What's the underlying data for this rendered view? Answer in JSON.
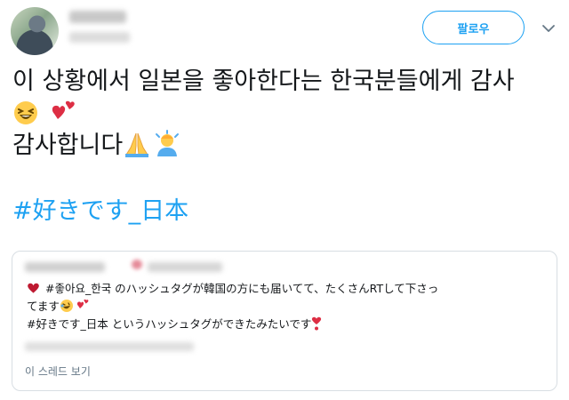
{
  "header": {
    "follow_label": "팔로우"
  },
  "tweet": {
    "line1": "이 상황에서 일본을 좋아한다는 한국분들에게 감사",
    "line3": "감사합니다",
    "hashtag": "#好きです_日本"
  },
  "quoted_tweet": {
    "line1": " #좋아요_한국 のハッシュタグが韓国の方にも届いてて、たくさんRTして下さっ",
    "line2": "てます",
    "line3": "#好きです_日本 というハッシュタグができたみたいです",
    "thread_link": "이 스레드 보기"
  },
  "colors": {
    "accent": "#1da1f2",
    "text": "#14171a",
    "muted": "#657786",
    "border": "#d8dee3"
  },
  "icons": [
    "chevron-down-icon",
    "laughing-emoji",
    "two-hearts-emoji",
    "folded-hands-emoji",
    "person-bowing-emoji",
    "red-heart-emoji",
    "rofl-emoji",
    "heavy-heart-exclamation-emoji"
  ]
}
